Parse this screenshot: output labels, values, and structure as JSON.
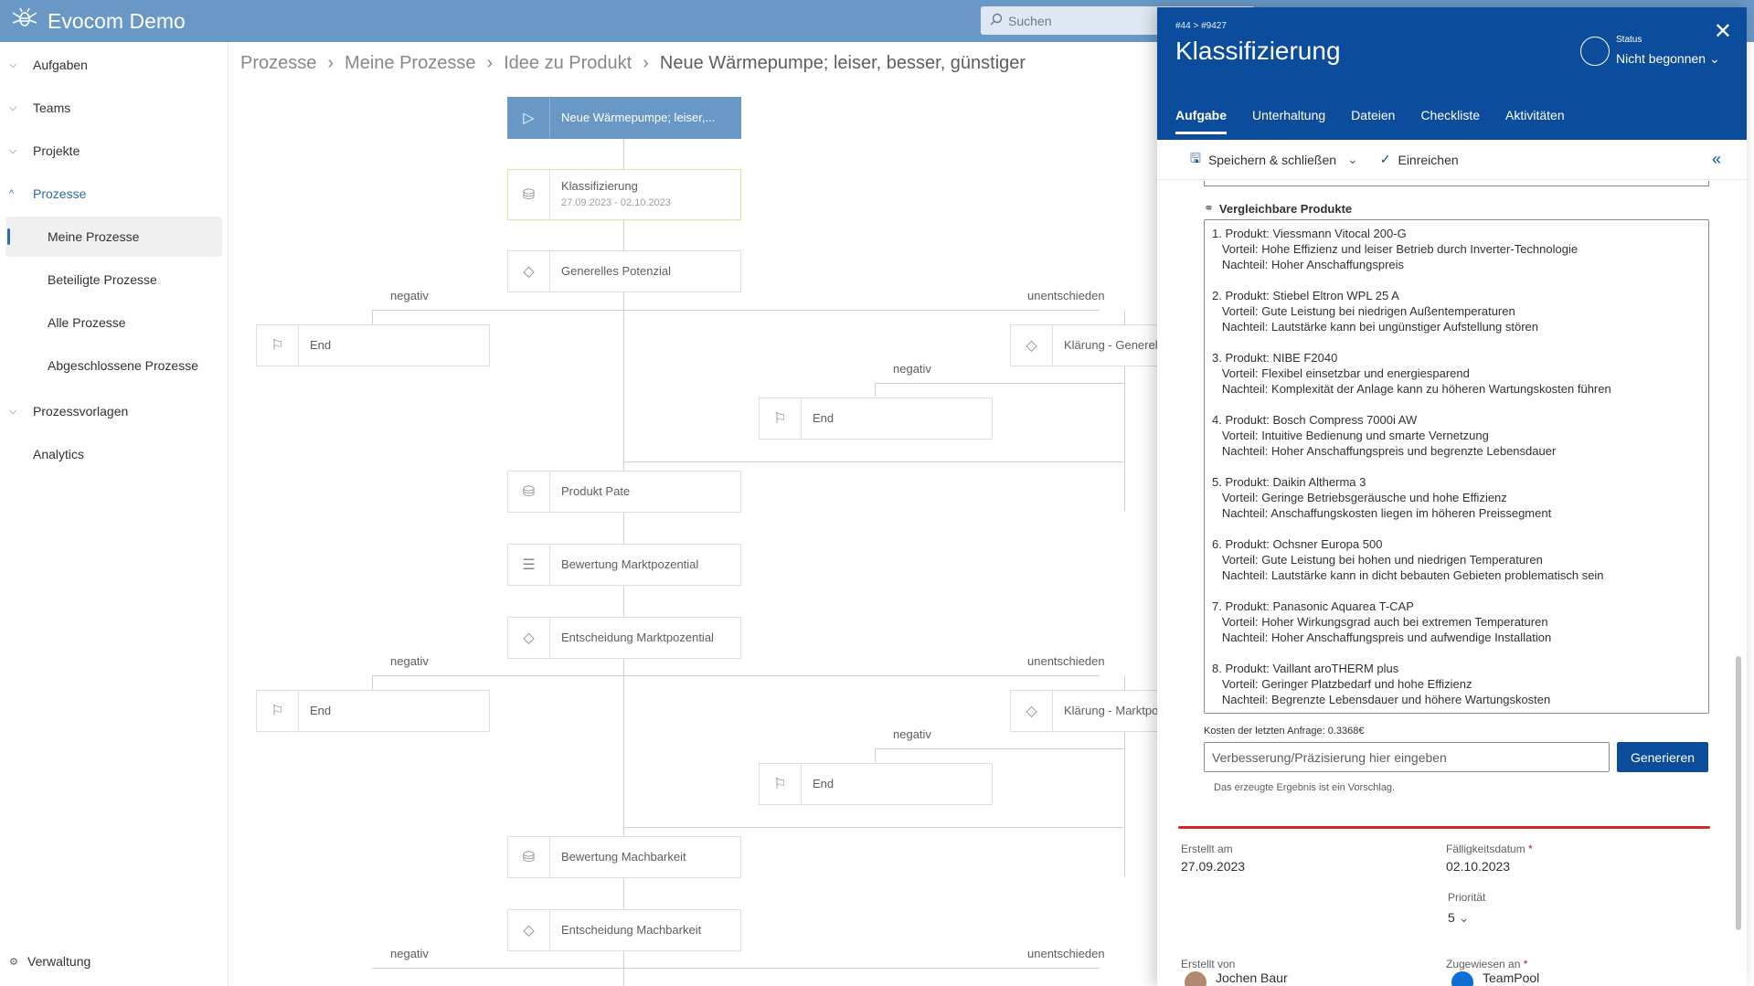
{
  "app": {
    "title": "Evocom Demo",
    "search_placeholder": "Suchen"
  },
  "sidebar": {
    "items": [
      {
        "label": "Aufgaben"
      },
      {
        "label": "Teams"
      },
      {
        "label": "Projekte"
      },
      {
        "label": "Prozesse"
      },
      {
        "label": "Prozessvorlagen"
      },
      {
        "label": "Analytics"
      }
    ],
    "sub_items": [
      {
        "label": "Meine Prozesse"
      },
      {
        "label": "Beteiligte Prozesse"
      },
      {
        "label": "Alle Prozesse"
      },
      {
        "label": "Abgeschlossene Prozesse"
      }
    ],
    "footer": "Verwaltung"
  },
  "breadcrumb": [
    "Prozesse",
    "Meine Prozesse",
    "Idee zu Produkt",
    "Neue Wärmepumpe; leiser, besser, günstiger"
  ],
  "flow": {
    "start": "Neue Wärmepumpe; leiser,...",
    "klass": "Klassifizierung",
    "klass_dates": "27.09.2023 - 02.10.2023",
    "n1": "Generelles Potenzial",
    "end": "End",
    "klar1": "Klärung - Generell",
    "klar2": "Klärung - Marktpo",
    "pate": "Produkt Pate",
    "markt": "Bewertung Marktpozential",
    "ent_markt": "Entscheidung Marktpozential",
    "mach": "Bewertung Machbarkeit",
    "ent_mach": "Entscheidung Machbarkeit",
    "negativ": "negativ",
    "unent": "unentschieden"
  },
  "panel": {
    "id": "#44 >  #9427",
    "title": "Klassifizierung",
    "status_label": "Status",
    "status_value": "Nicht begonnen",
    "tabs": [
      "Aufgabe",
      "Unterhaltung",
      "Dateien",
      "Checkliste",
      "Aktivitäten"
    ],
    "save_close": "Speichern & schließen",
    "submit": "Einreichen",
    "section": "Vergleichbare Produkte",
    "products_text": "1. Produkt: Viessmann Vitocal 200-G\n   Vorteil: Hohe Effizienz und leiser Betrieb durch Inverter-Technologie\n   Nachteil: Hoher Anschaffungspreis\n\n2. Produkt: Stiebel Eltron WPL 25 A\n   Vorteil: Gute Leistung bei niedrigen Außentemperaturen\n   Nachteil: Lautstärke kann bei ungünstiger Aufstellung stören\n\n3. Produkt: NIBE F2040\n   Vorteil: Flexibel einsetzbar und energiesparend\n   Nachteil: Komplexität der Anlage kann zu höheren Wartungskosten führen\n\n4. Produkt: Bosch Compress 7000i AW\n   Vorteil: Intuitive Bedienung und smarte Vernetzung\n   Nachteil: Hoher Anschaffungspreis und begrenzte Lebensdauer\n\n5. Produkt: Daikin Altherma 3\n   Vorteil: Geringe Betriebsgeräusche und hohe Effizienz\n   Nachteil: Anschaffungskosten liegen im höheren Preissegment\n\n6. Produkt: Ochsner Europa 500\n   Vorteil: Gute Leistung bei hohen und niedrigen Temperaturen\n   Nachteil: Lautstärke kann in dicht bebauten Gebieten problematisch sein\n\n7. Produkt: Panasonic Aquarea T-CAP\n   Vorteil: Hoher Wirkungsgrad auch bei extremen Temperaturen\n   Nachteil: Hoher Anschaffungspreis und aufwendige Installation\n\n8. Produkt: Vaillant aroTHERM plus\n   Vorteil: Geringer Platzbedarf und hohe Effizienz\n   Nachteil: Begrenzte Lebensdauer und höhere Wartungskosten",
    "cost": "Kosten der letzten Anfrage: 0.3368€",
    "refine_placeholder": "Verbesserung/Präzisierung hier eingeben",
    "generate": "Generieren",
    "hint": "Das erzeugte Ergebnis ist ein Vorschlag.",
    "created_label": "Erstellt am",
    "created_value": "27.09.2023",
    "due_label": "Fälligkeitsdatum",
    "due_value": "02.10.2023",
    "prio_label": "Priorität",
    "prio_value": "5",
    "creator_label": "Erstellt von",
    "creator_value": "Jochen Baur",
    "assigned_label": "Zugewiesen an",
    "assigned_value": "TeamPool"
  }
}
